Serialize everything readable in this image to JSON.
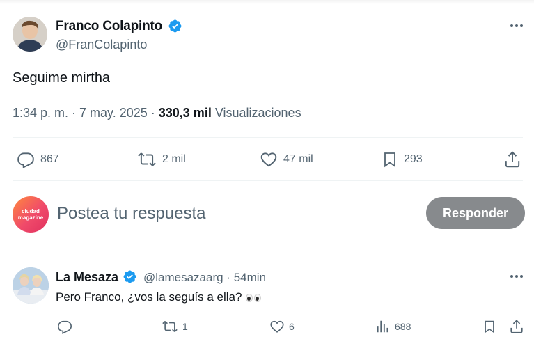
{
  "tweet": {
    "author_name": "Franco Colapinto",
    "author_handle": "@FranColapinto",
    "text": "Seguime mirtha",
    "time": "1:34 p. m. · 7 may. 2025 · ",
    "views_count": "330,3 mil",
    "views_label": " Visualizaciones",
    "stats": {
      "replies": "867",
      "retweets": "2 mil",
      "likes": "47 mil",
      "bookmarks": "293"
    }
  },
  "composer": {
    "avatar_text_line1": "ciudad",
    "avatar_text_line2": "magazine",
    "placeholder": "Postea tu respuesta",
    "reply_button": "Responder"
  },
  "reply": {
    "author_name": "La Mesaza",
    "author_handle_time": "@lamesazaarg · 54min",
    "text": "Pero Franco, ¿vos la seguís a ella?",
    "stats": {
      "retweets": "1",
      "likes": "6",
      "views": "688"
    }
  },
  "colors": {
    "verified_blue": "#1d9bf0",
    "secondary_text": "#536471",
    "reply_button_bg": "#878a8d"
  }
}
